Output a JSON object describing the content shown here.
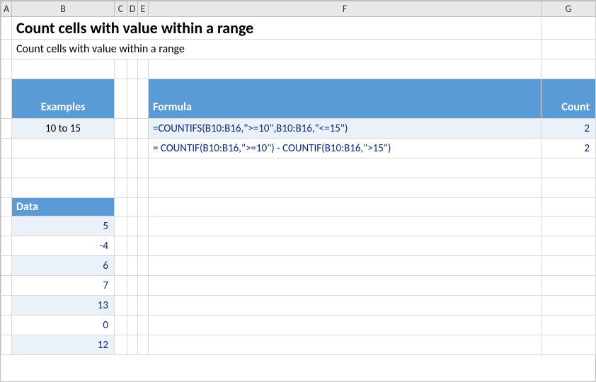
{
  "colLetters": {
    "a": "A",
    "b": "B",
    "c": "C",
    "d": "D",
    "e": "E",
    "f": "F",
    "g": "G"
  },
  "title": "Count cells with value within a range",
  "subtitle": "Count cells with value within a range",
  "headers": {
    "examples": "Examples",
    "formula": "Formula",
    "count": "Count",
    "data": "Data"
  },
  "exampleLabel": "10 to 15",
  "formulas": [
    {
      "text": "=COUNTIFS(B10:B16,\">=10\",B10:B16,\"<=15\")",
      "count": 2
    },
    {
      "text": "= COUNTIF(B10:B16,\">=10\") - COUNTIF(B10:B16,\">15\")",
      "count": 2
    }
  ],
  "dataValues": [
    5,
    -4,
    6,
    7,
    13,
    0,
    12
  ],
  "chart_data": {
    "type": "table",
    "title": "Count cells with value within a range",
    "sections": {
      "examples": {
        "header": "Examples",
        "rows": [
          "10 to 15"
        ]
      },
      "formula_count": {
        "headers": [
          "Formula",
          "Count"
        ],
        "rows": [
          [
            "=COUNTIFS(B10:B16,\">=10\",B10:B16,\"<=15\")",
            2
          ],
          [
            "= COUNTIF(B10:B16,\">=10\") - COUNTIF(B10:B16,\">15\")",
            2
          ]
        ]
      },
      "data": {
        "header": "Data",
        "values": [
          5,
          -4,
          6,
          7,
          13,
          0,
          12
        ]
      }
    }
  }
}
